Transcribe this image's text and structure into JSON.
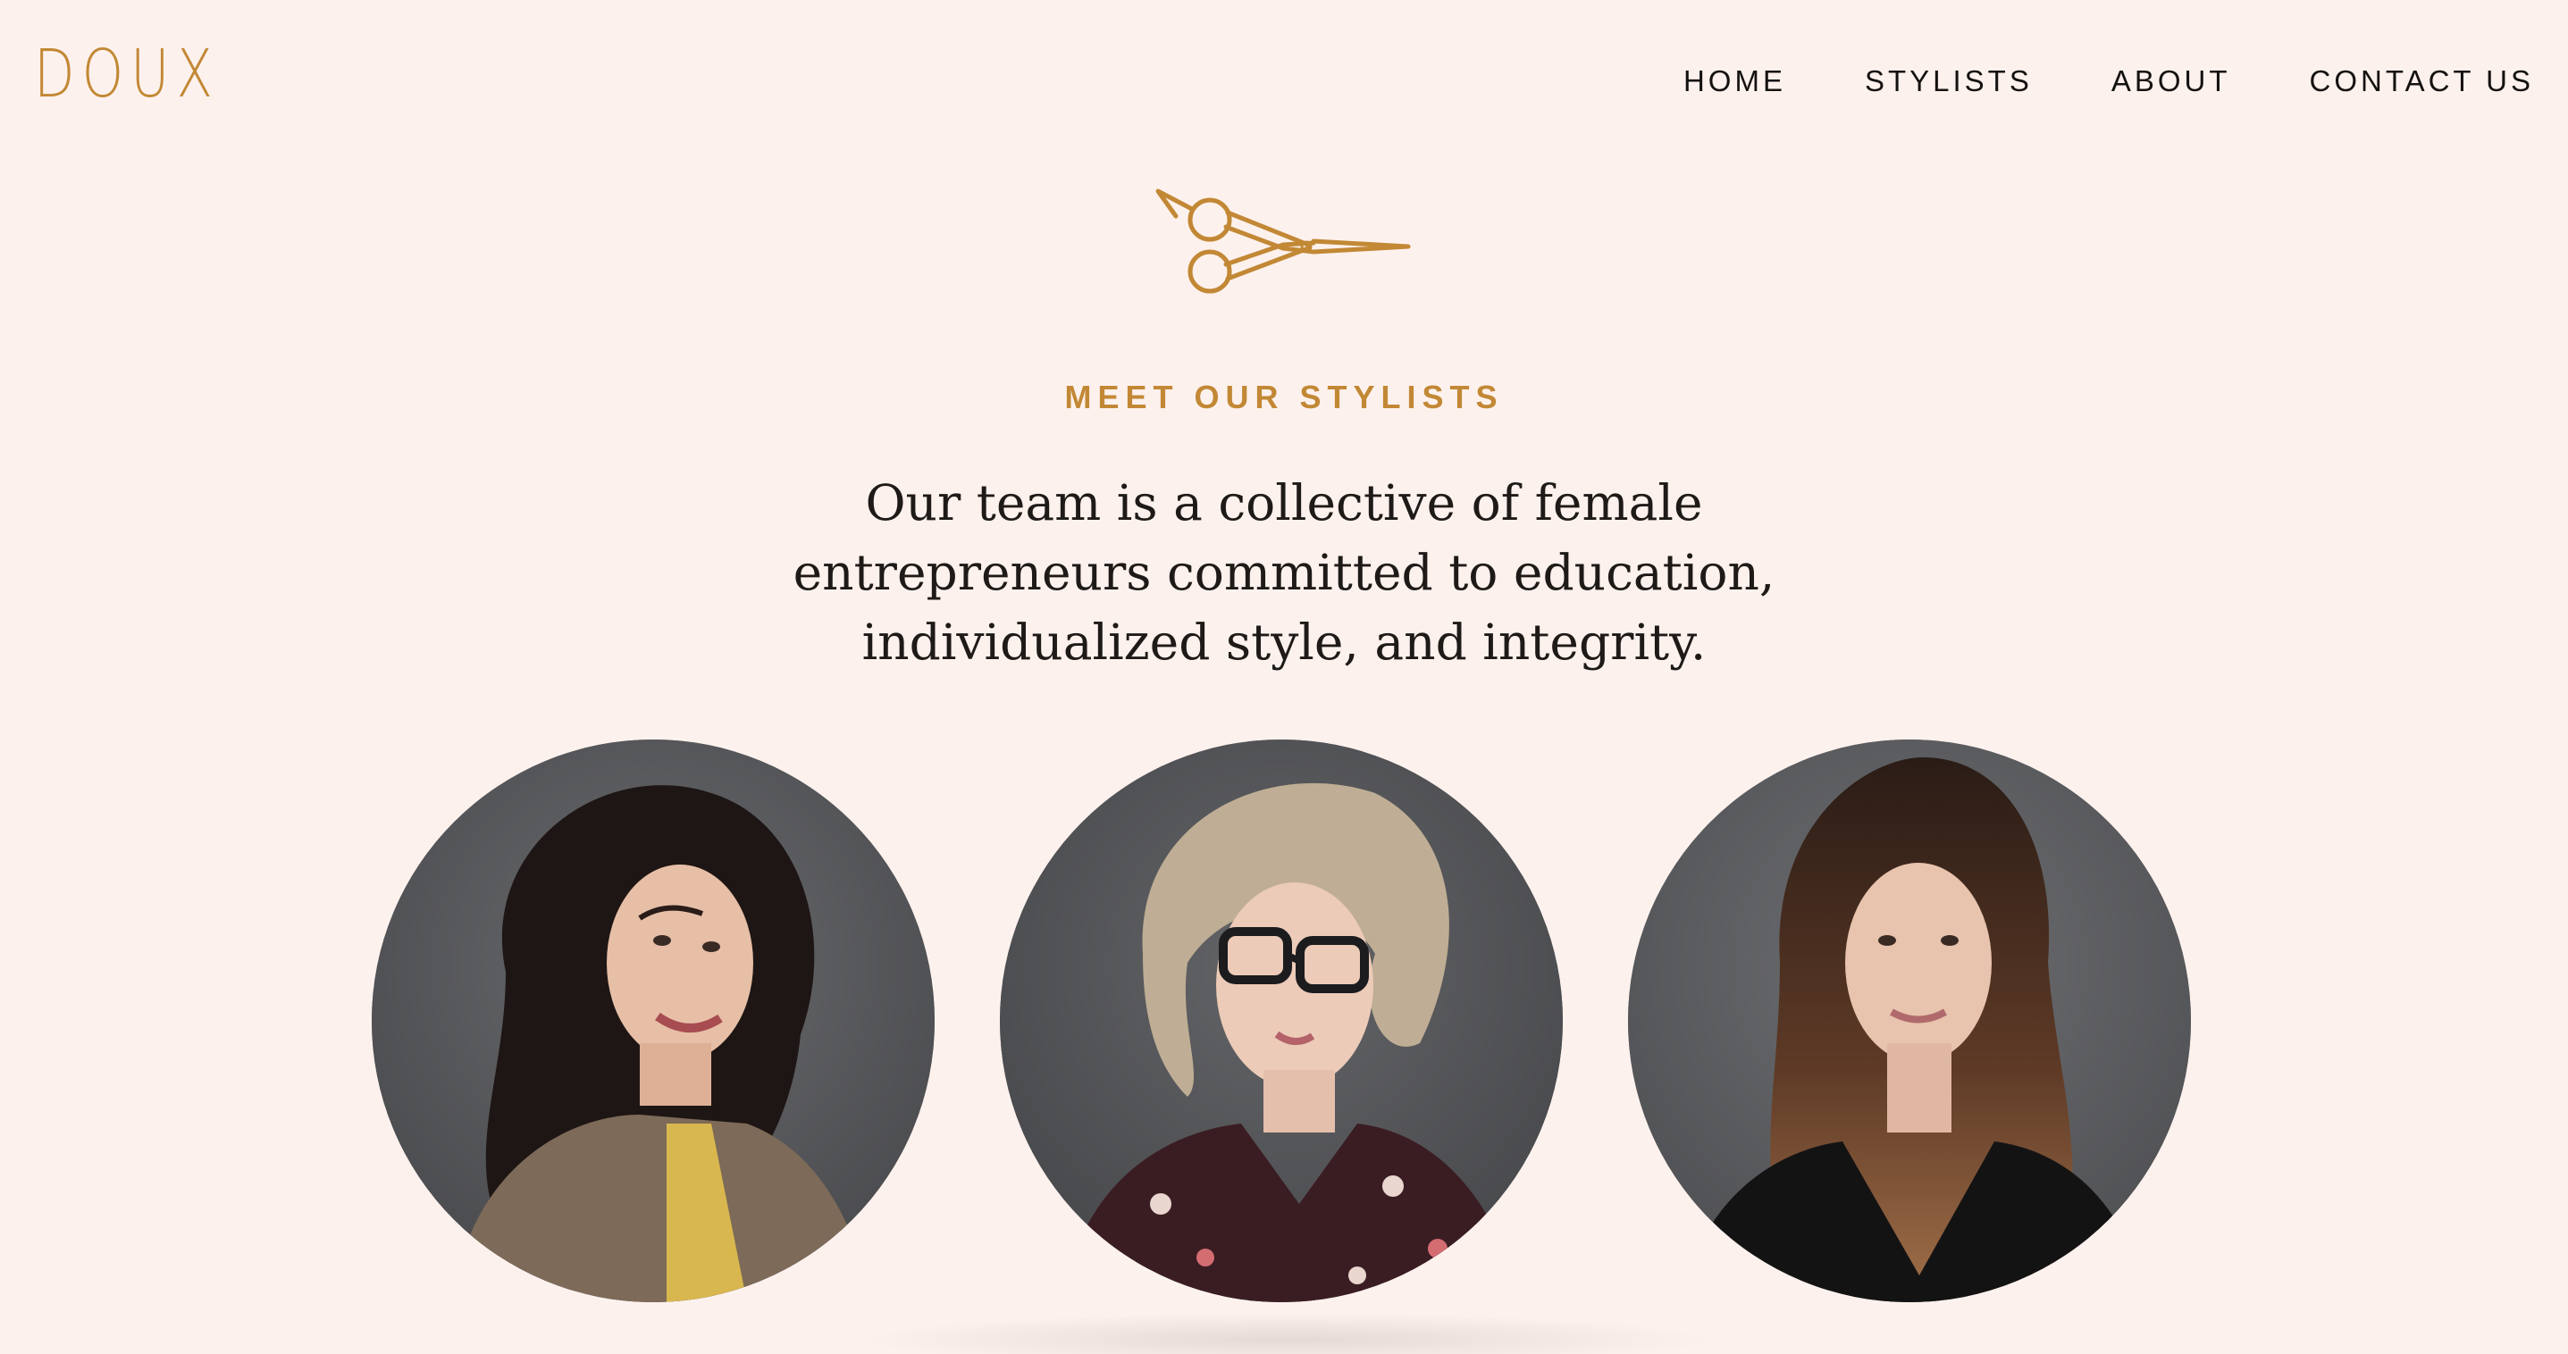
{
  "header": {
    "logo": "DOUX",
    "nav": [
      {
        "label": "HOME"
      },
      {
        "label": "STYLISTS"
      },
      {
        "label": "ABOUT"
      },
      {
        "label": "CONTACT US"
      }
    ]
  },
  "hero": {
    "icon": "scissors-icon",
    "kicker": "MEET OUR STYLISTS",
    "intro": "Our team is a collective of female entrepreneurs committed to education, individualized style, and integrity."
  },
  "stylists": [
    {
      "photo": "stylist-photo-dark-wavy-hair-tweed-jacket"
    },
    {
      "photo": "stylist-photo-short-blonde-hair-glasses-floral-top"
    },
    {
      "photo": "stylist-photo-long-wavy-balayage-hair-black-top"
    }
  ],
  "colors": {
    "background": "#fdf1ed",
    "accent": "#c28835",
    "text": "#1e1a18",
    "portrait_backdrop": "#56575a"
  }
}
